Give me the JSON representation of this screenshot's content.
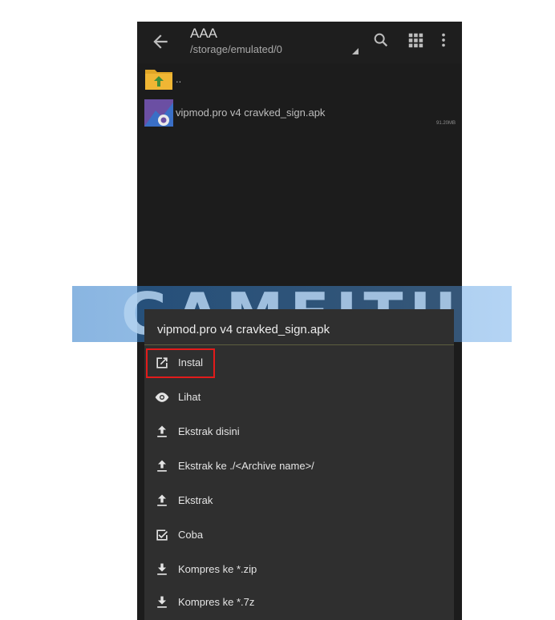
{
  "appbar": {
    "title": "AAA",
    "path": "/storage/emulated/0"
  },
  "files": [
    {
      "name": "..",
      "type": "folder-up",
      "size": ""
    },
    {
      "name": "vipmod.pro v4 cravked_sign.apk",
      "type": "apk",
      "size": "91.20MB"
    }
  ],
  "watermark": "GAMEITU",
  "sheet": {
    "title": "vipmod.pro v4 cravked_sign.apk",
    "items": [
      {
        "label": "Instal",
        "icon": "open-external-icon"
      },
      {
        "label": "Lihat",
        "icon": "eye-icon"
      },
      {
        "label": "Ekstrak disini",
        "icon": "upload-icon"
      },
      {
        "label": "Ekstrak ke ./<Archive name>/",
        "icon": "upload-icon"
      },
      {
        "label": "Ekstrak",
        "icon": "upload-icon"
      },
      {
        "label": "Coba",
        "icon": "checkbox-icon"
      },
      {
        "label": "Kompres ke *.zip",
        "icon": "download-icon"
      },
      {
        "label": "Kompres ke *.7z",
        "icon": "download-icon"
      }
    ]
  },
  "colors": {
    "highlight": "#e21b1b",
    "sheet_bg": "#2f2f2f",
    "screen_bg": "#1c1c1c"
  }
}
